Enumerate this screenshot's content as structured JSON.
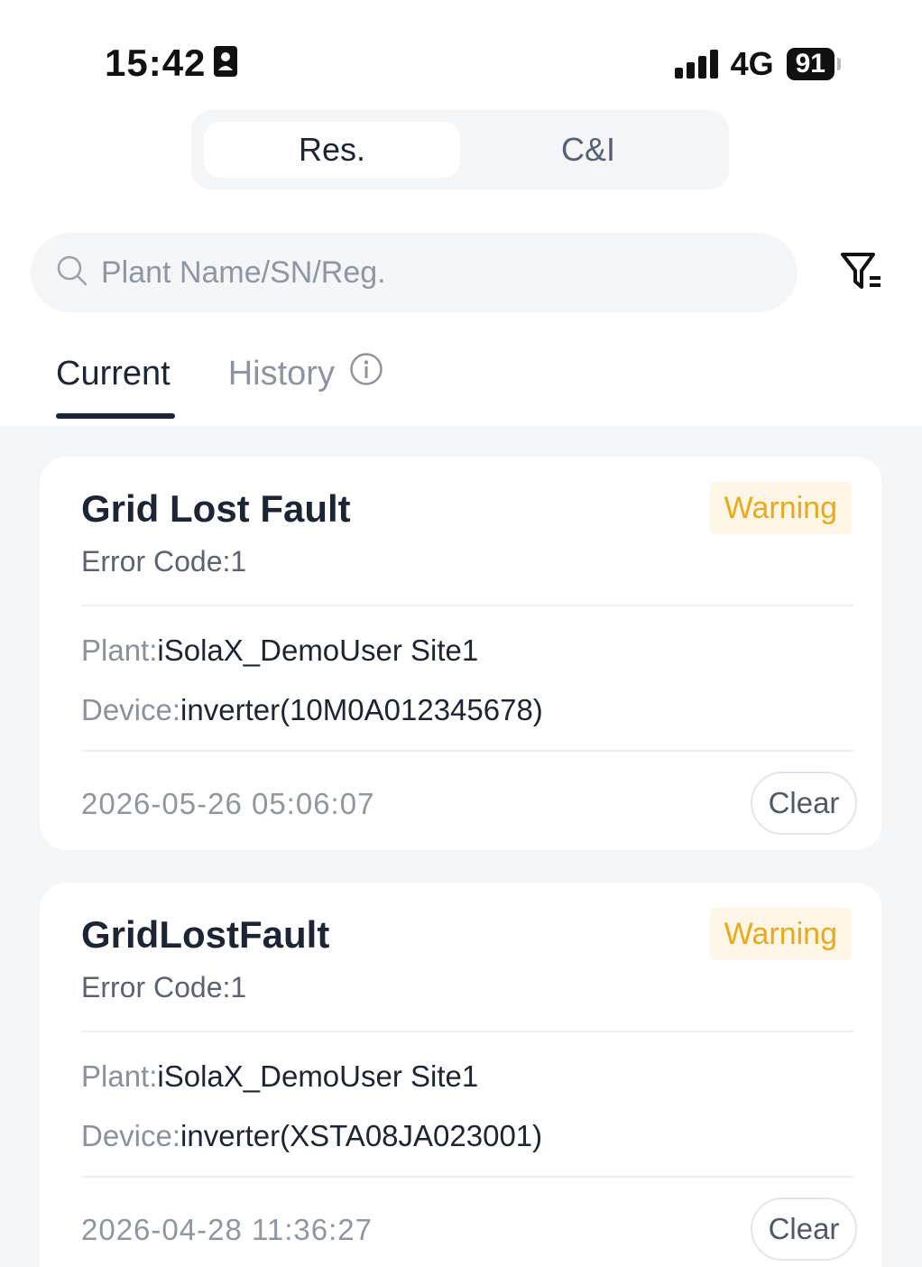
{
  "status_bar": {
    "time": "15:42",
    "network": "4G",
    "battery": "91"
  },
  "segment_tabs": [
    {
      "label": "Res.",
      "active": true
    },
    {
      "label": "C&I",
      "active": false
    }
  ],
  "search": {
    "placeholder": "Plant Name/SN/Reg."
  },
  "tabs": {
    "current": "Current",
    "history": "History"
  },
  "alarms": [
    {
      "title": "Grid Lost Fault",
      "badge": "Warning",
      "error_code": "Error Code:1",
      "plant_label": "Plant:",
      "plant_value": "iSolaX_DemoUser Site1",
      "device_label": "Device:",
      "device_value": "inverter(10M0A012345678)",
      "timestamp": "2026-05-26 05:06:07",
      "clear_label": "Clear"
    },
    {
      "title": "GridLostFault",
      "badge": "Warning",
      "error_code": "Error Code:1",
      "plant_label": "Plant:",
      "plant_value": "iSolaX_DemoUser Site1",
      "device_label": "Device:",
      "device_value": "inverter(XSTA08JA023001)",
      "timestamp": "2026-04-28 11:36:27",
      "clear_label": "Clear"
    }
  ],
  "colors": {
    "warning": "#e9a91a",
    "warning_bg": "#fdf6e6",
    "primary_text": "#1c2533",
    "page_bg": "#f4f5f7"
  }
}
